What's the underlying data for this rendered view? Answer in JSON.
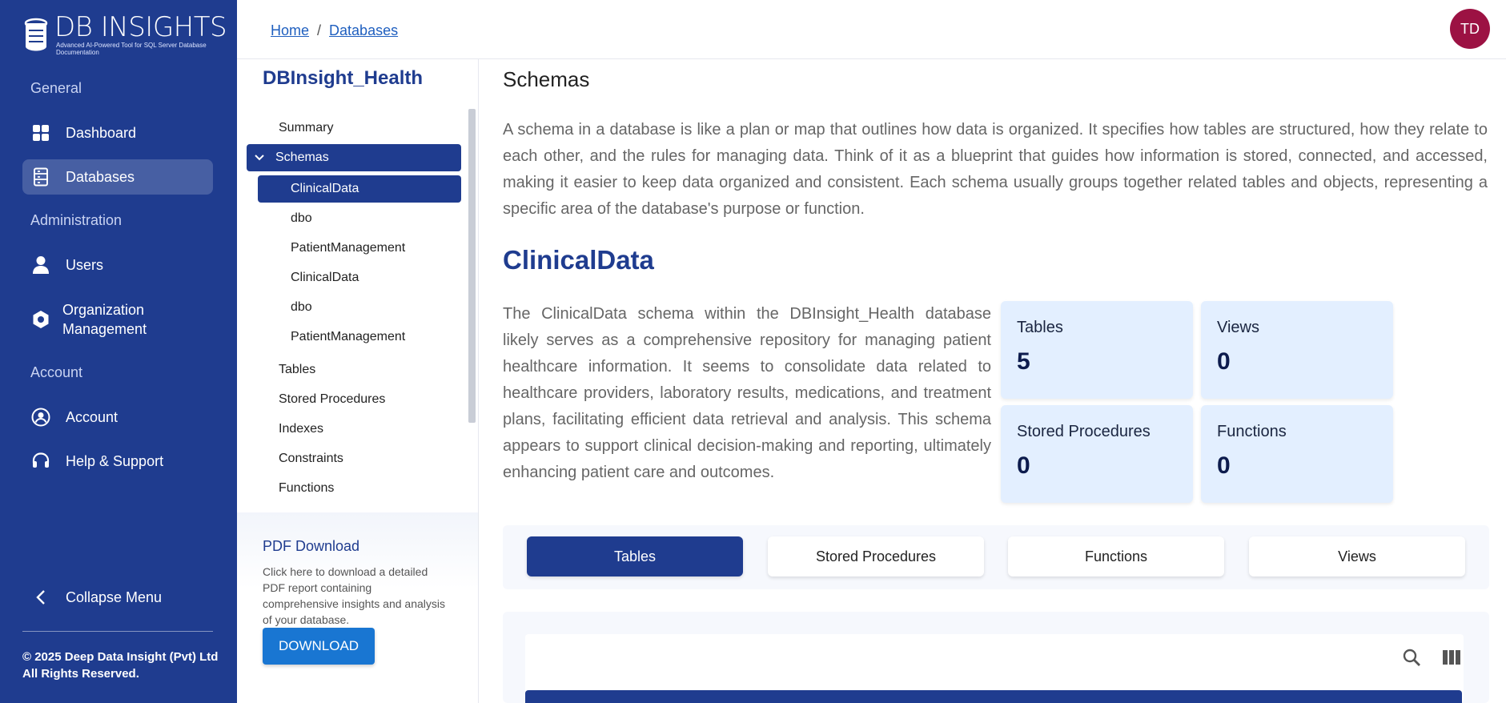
{
  "brand": {
    "name": "DB INSIGHTS",
    "tagline": "Advanced AI-Powered Tool for SQL Server Database Documentation"
  },
  "sidebar": {
    "sections": {
      "general": "General",
      "administration": "Administration",
      "account": "Account"
    },
    "items": {
      "dashboard": "Dashboard",
      "databases": "Databases",
      "users": "Users",
      "org_line1": "Organization",
      "org_line2": "Management",
      "account": "Account",
      "help": "Help & Support"
    },
    "collapse": "Collapse Menu",
    "copyright_line1": "© 2025 Deep Data Insight (Pvt) Ltd",
    "copyright_line2": "All Rights Reserved."
  },
  "header": {
    "breadcrumb": [
      "Home",
      "Databases"
    ],
    "avatar_initials": "TD"
  },
  "tree": {
    "db_name": "DBInsight_Health",
    "items": {
      "summary": "Summary",
      "schemas": "Schemas",
      "s1": "ClinicalData",
      "s2": "dbo",
      "s3": "PatientManagement",
      "s4": "ClinicalData",
      "s5": "dbo",
      "s6": "PatientManagement",
      "tables": "Tables",
      "stored_procedures": "Stored Procedures",
      "indexes": "Indexes",
      "constraints": "Constraints",
      "functions": "Functions"
    }
  },
  "pdf": {
    "title": "PDF Download",
    "description": "Click here to download a detailed PDF report containing comprehensive insights and analysis of your database.",
    "button": "DOWNLOAD"
  },
  "main": {
    "title": "Schemas",
    "intro": "A schema in a database is like a plan or map that outlines how data is organized. It specifies how tables are structured, how they relate to each other, and the rules for managing data. Think of it as a blueprint that guides how information is stored, connected, and accessed, making it easier to keep data organized and consistent. Each schema usually groups together related tables and objects, representing a specific area of the database's purpose or function.",
    "schema_name": "ClinicalData",
    "schema_description": "The ClinicalData schema within the DBInsight_Health database likely serves as a comprehensive repository for managing patient healthcare information. It seems to consolidate data related to healthcare providers, laboratory results, medications, and treatment plans, facilitating efficient data retrieval and analysis. This schema appears to support clinical decision-making and reporting, ultimately enhancing patient care and outcomes.",
    "stats": {
      "tables": {
        "label": "Tables",
        "value": "5"
      },
      "views": {
        "label": "Views",
        "value": "0"
      },
      "procs": {
        "label": "Stored Procedures",
        "value": "0"
      },
      "functions": {
        "label": "Functions",
        "value": "0"
      }
    },
    "tabs": [
      "Tables",
      "Stored Procedures",
      "Functions",
      "Views"
    ]
  },
  "colors": {
    "primary": "#1f3c8f",
    "accent": "#1976d2",
    "avatar": "#9c1243",
    "stat_bg": "#e3efff"
  }
}
